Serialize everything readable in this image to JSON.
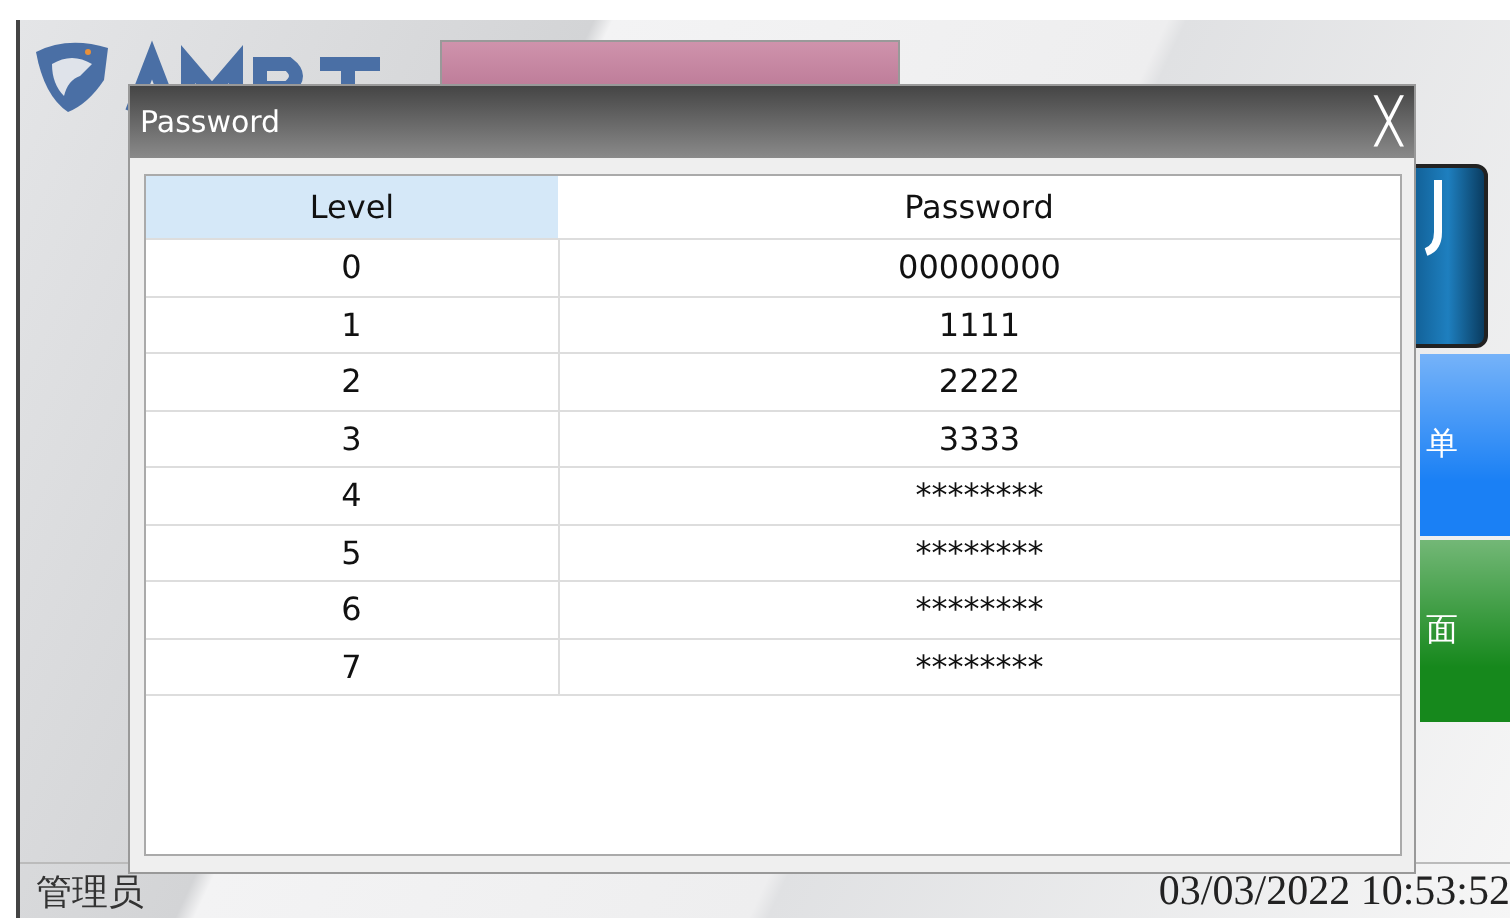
{
  "side_buttons": [
    {
      "label": "单",
      "color": "#1a80f5"
    },
    {
      "label": "面",
      "color": "#16881c"
    }
  ],
  "status_bar": {
    "user": "管理员",
    "datetime": "03/03/2022 10:53:52"
  },
  "dialog": {
    "title": "Password",
    "close": "╳",
    "columns": [
      {
        "label": "Level",
        "selected": true
      },
      {
        "label": "Password",
        "selected": false
      }
    ],
    "rows": [
      [
        "0",
        "00000000"
      ],
      [
        "1",
        "1111"
      ],
      [
        "2",
        "2222"
      ],
      [
        "3",
        "3333"
      ],
      [
        "4",
        "********"
      ],
      [
        "5",
        "********"
      ],
      [
        "6",
        "********"
      ],
      [
        "7",
        "********"
      ]
    ]
  }
}
